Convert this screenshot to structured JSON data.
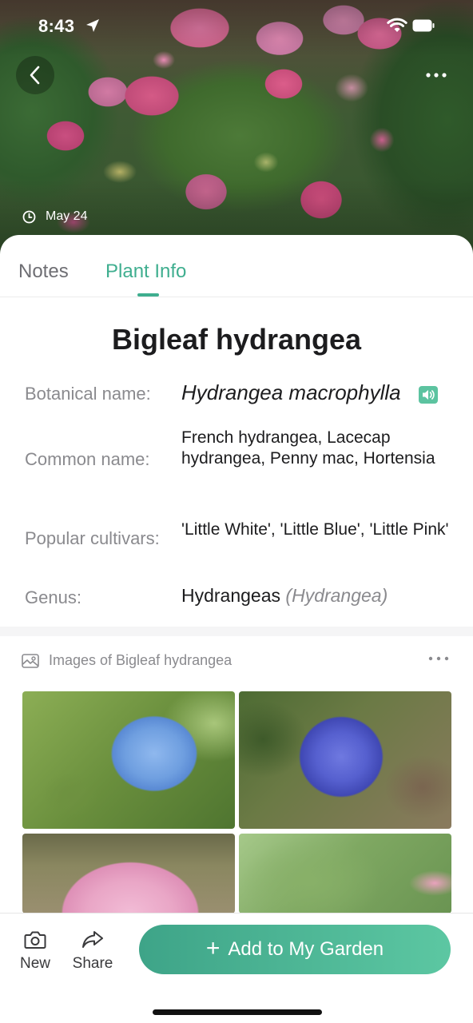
{
  "status_bar": {
    "time": "8:43",
    "icons": [
      "location-arrow-icon",
      "wifi-icon",
      "battery-icon"
    ]
  },
  "header": {
    "back_icon": "chevron-left-icon",
    "more_icon": "more-horizontal-icon",
    "date_icon": "clock-icon",
    "date": "May 24"
  },
  "tabs": [
    {
      "label": "Notes",
      "active": false
    },
    {
      "label": "Plant Info",
      "active": true
    }
  ],
  "plant": {
    "title": "Bigleaf hydrangea",
    "fields": {
      "botanical": {
        "label": "Botanical name:",
        "value": "Hydrangea macrophylla",
        "icon": "speaker-icon"
      },
      "common": {
        "label": "Common name:",
        "value": "French hydrangea, Lacecap hydrangea, Penny mac, Hortensia"
      },
      "cultivars": {
        "label": "Popular cultivars:",
        "value": "'Little White', 'Little Blue', 'Little Pink'"
      },
      "genus": {
        "label": "Genus:",
        "value": "Hydrangeas",
        "scientific": "(Hydrangea)"
      }
    }
  },
  "images": {
    "icon": "gallery-icon",
    "title": "Images of Bigleaf hydrangea",
    "more_icon": "more-horizontal-icon"
  },
  "bottom_bar": {
    "new_label": "New",
    "new_icon": "camera-icon",
    "share_label": "Share",
    "share_icon": "share-arrow-icon",
    "add_label": "Add to My Garden",
    "add_icon": "plus-icon"
  },
  "colors": {
    "accent": "#3fae8f",
    "button_gradient_start": "#3ea488",
    "button_gradient_end": "#5cc7a2"
  }
}
